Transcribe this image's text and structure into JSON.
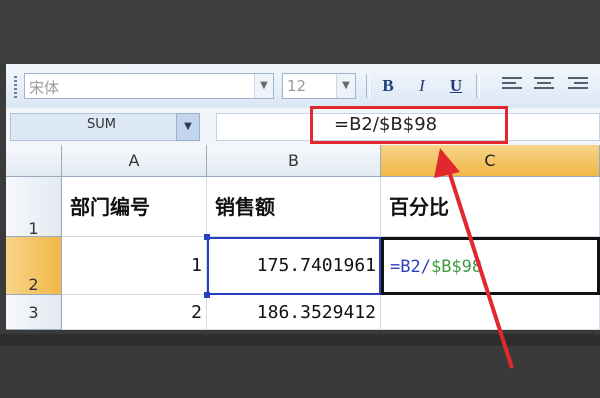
{
  "toolbar": {
    "font_name": "宋体",
    "font_size": "12",
    "bold_label": "B",
    "italic_label": "I",
    "underline_label": "U"
  },
  "formula_bar": {
    "name_box": "SUM",
    "formula": "=B2/$B$98"
  },
  "columns": [
    {
      "label": "A"
    },
    {
      "label": "B"
    },
    {
      "label": "C"
    }
  ],
  "rows": [
    {
      "label": "1"
    },
    {
      "label": "2"
    },
    {
      "label": "3"
    }
  ],
  "cells": {
    "A1": "部门编号",
    "B1": "销售额",
    "C1": "百分比",
    "A2": "1",
    "B2": "175.7401961",
    "A3": "2",
    "B3": "186.3529412"
  },
  "editing": {
    "cell": "C2",
    "part1": "=B2/",
    "part2": "$B$98"
  },
  "colors": {
    "highlight_box": "#e0282e",
    "active_header": "#f0b847",
    "reference_blue": "#2f3fbe",
    "reference_green": "#3f9a3f"
  }
}
